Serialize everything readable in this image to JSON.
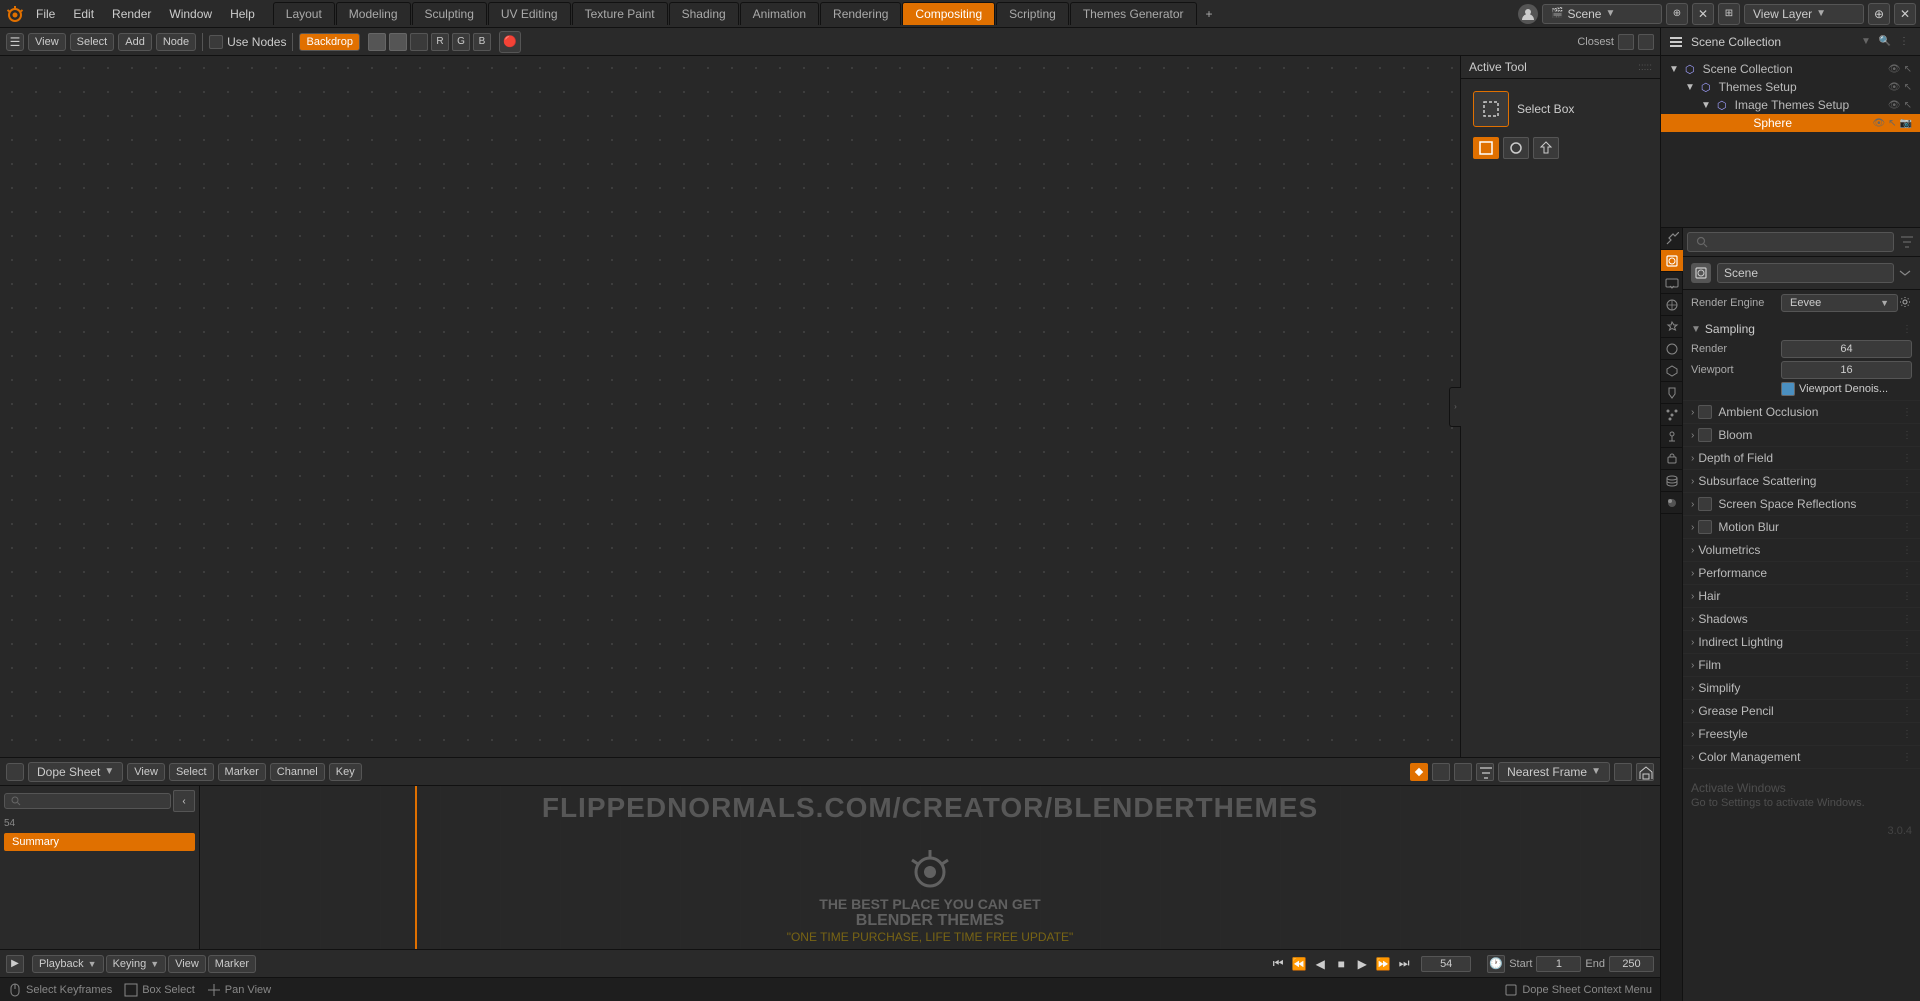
{
  "topbar": {
    "menus": [
      "File",
      "Edit",
      "Render",
      "Window",
      "Help"
    ],
    "workspaces": [
      {
        "label": "Layout",
        "active": false
      },
      {
        "label": "Modeling",
        "active": false
      },
      {
        "label": "Sculpting",
        "active": false
      },
      {
        "label": "UV Editing",
        "active": false
      },
      {
        "label": "Texture Paint",
        "active": false
      },
      {
        "label": "Shading",
        "active": false
      },
      {
        "label": "Animation",
        "active": false
      },
      {
        "label": "Rendering",
        "active": false
      },
      {
        "label": "Compositing",
        "active": true
      },
      {
        "label": "Scripting",
        "active": false
      },
      {
        "label": "Themes Generator",
        "active": false
      }
    ],
    "scene_label": "Scene",
    "view_layer_label": "View Layer"
  },
  "node_toolbar": {
    "view": "View",
    "select": "Select",
    "add": "Add",
    "node": "Node",
    "use_nodes": "Use Nodes",
    "backdrop": "Backdrop",
    "method_label": "Closest"
  },
  "dope_toolbar": {
    "sheet_type": "Dope Sheet",
    "view": "View",
    "select": "Select",
    "marker": "Marker",
    "channel": "Channel",
    "key": "Key",
    "frame_method": "Nearest Frame"
  },
  "dope_content": {
    "summary": "Summary"
  },
  "timeline": {
    "frame_current": "54",
    "start_label": "Start",
    "start_val": "1",
    "end_label": "End",
    "end_val": "250"
  },
  "watermark": {
    "url": "FLIPPEDNORMALS.COM/CREATOR/BLENDERTHEMES",
    "tagline1": "THE BEST PLACE YOU CAN GET",
    "tagline2": "BLENDER THEMES",
    "tagline3": "\"ONE TIME PURCHASE, LIFE TIME FREE UPDATE\""
  },
  "outliner": {
    "title": "Scene Collection",
    "items": [
      {
        "indent": 0,
        "label": "Scene Collection",
        "icon": "collection",
        "has_arrow": true,
        "expanded": true
      },
      {
        "indent": 1,
        "label": "Themes Setup",
        "icon": "collection",
        "has_arrow": true,
        "expanded": true
      },
      {
        "indent": 2,
        "label": "Image Themes Setup",
        "icon": "collection",
        "has_arrow": true,
        "expanded": true
      },
      {
        "indent": 3,
        "label": "Sphere",
        "icon": "object",
        "has_arrow": false,
        "expanded": false,
        "active": true
      }
    ]
  },
  "properties": {
    "tabs": [
      {
        "icon": "⚙",
        "label": "tool"
      },
      {
        "icon": "🎬",
        "label": "render",
        "active": true
      },
      {
        "icon": "📷",
        "label": "output"
      },
      {
        "icon": "🖼",
        "label": "view"
      },
      {
        "icon": "💡",
        "label": "scene"
      },
      {
        "icon": "🌍",
        "label": "world"
      },
      {
        "icon": "▶",
        "label": "object"
      },
      {
        "icon": "◼",
        "label": "modifier"
      },
      {
        "icon": "⬡",
        "label": "particles"
      },
      {
        "icon": "🔧",
        "label": "physics"
      },
      {
        "icon": "🔗",
        "label": "constraints"
      },
      {
        "icon": "📐",
        "label": "data"
      },
      {
        "icon": "🎨",
        "label": "material"
      }
    ],
    "scene_name": "Scene",
    "render_engine_label": "Render Engine",
    "render_engine_value": "Eevee",
    "sampling_label": "Sampling",
    "render_label": "Render",
    "render_value": "64",
    "viewport_label": "Viewport",
    "viewport_value": "16",
    "viewport_denoise": "Viewport Denois...",
    "effects": [
      {
        "label": "Ambient Occlusion",
        "has_checkbox": true
      },
      {
        "label": "Bloom",
        "has_checkbox": true
      },
      {
        "label": "Depth of Field",
        "has_checkbox": false
      },
      {
        "label": "Subsurface Scattering",
        "has_checkbox": false
      },
      {
        "label": "Screen Space Reflections",
        "has_checkbox": true
      },
      {
        "label": "Motion Blur",
        "has_checkbox": true
      },
      {
        "label": "Volumetrics",
        "has_checkbox": false
      },
      {
        "label": "Performance",
        "has_checkbox": false
      },
      {
        "label": "Hair",
        "has_checkbox": false
      },
      {
        "label": "Shadows",
        "has_checkbox": false
      },
      {
        "label": "Indirect Lighting",
        "has_checkbox": false
      },
      {
        "label": "Film",
        "has_checkbox": false
      },
      {
        "label": "Simplify",
        "has_checkbox": false
      },
      {
        "label": "Grease Pencil",
        "has_checkbox": false
      },
      {
        "label": "Freestyle",
        "has_checkbox": false
      },
      {
        "label": "Color Management",
        "has_checkbox": false
      }
    ]
  },
  "status_bar": {
    "select_keyframes": "Select Keyframes",
    "box_select": "Box Select",
    "pan_view": "Pan View",
    "context_menu": "Dope Sheet Context Menu"
  },
  "active_tool": {
    "title": "Active Tool",
    "tool_name": "Select Box"
  },
  "blender_version": "3.0.4"
}
